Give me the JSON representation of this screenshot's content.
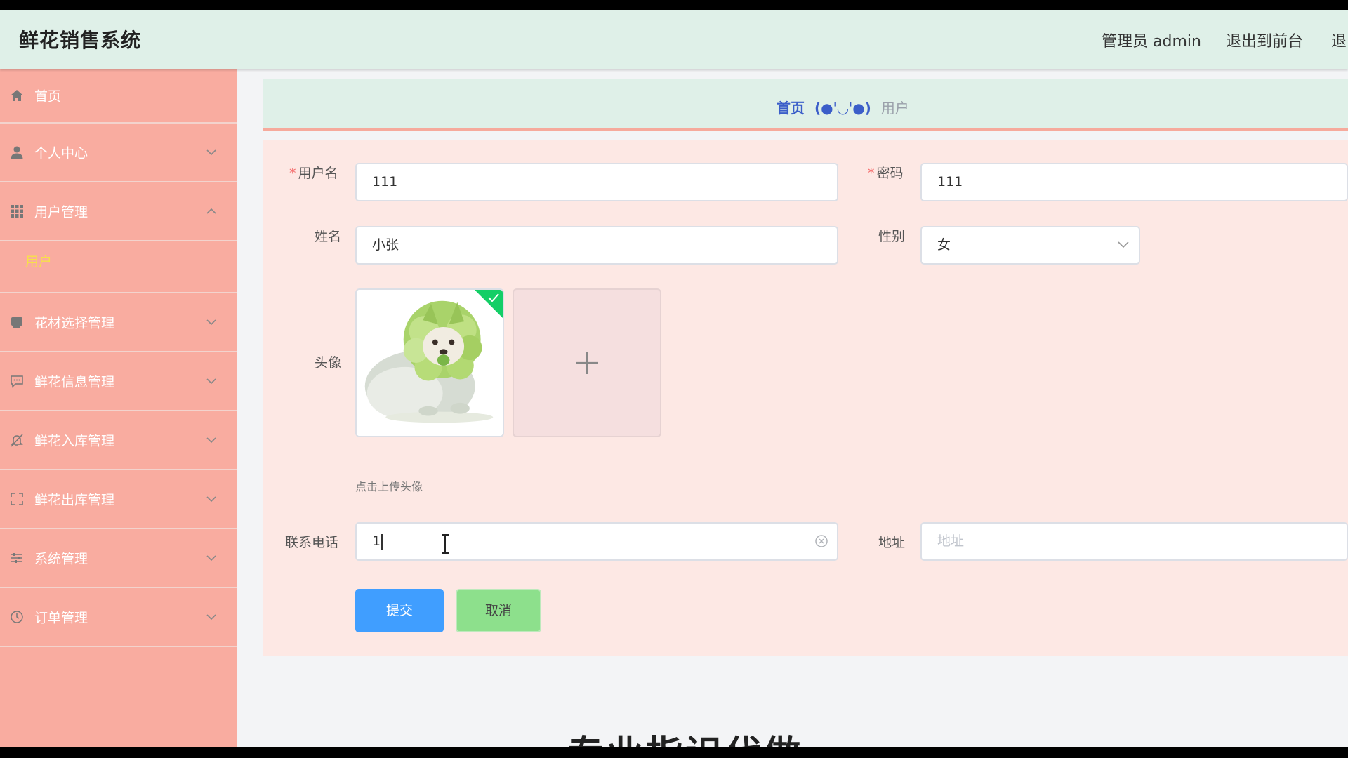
{
  "app": {
    "title": "鲜花销售系统"
  },
  "topbar": {
    "user_text": "管理员 admin",
    "back_front_label": "退出到前台",
    "logout_label": "退出"
  },
  "sidebar": {
    "items": [
      {
        "label": "首页",
        "icon": "home-icon",
        "expandable": false
      },
      {
        "label": "个人中心",
        "icon": "user-icon",
        "expandable": true,
        "expanded": false
      },
      {
        "label": "用户管理",
        "icon": "grid-icon",
        "expandable": true,
        "expanded": true,
        "children": [
          "用户"
        ]
      },
      {
        "label": "花材选择管理",
        "icon": "box-icon",
        "expandable": true,
        "expanded": false
      },
      {
        "label": "鲜花信息管理",
        "icon": "message-icon",
        "expandable": true,
        "expanded": false
      },
      {
        "label": "鲜花入库管理",
        "icon": "bell-off-icon",
        "expandable": true,
        "expanded": false
      },
      {
        "label": "鲜花出库管理",
        "icon": "fullscreen-icon",
        "expandable": true,
        "expanded": false
      },
      {
        "label": "系统管理",
        "icon": "sliders-icon",
        "expandable": true,
        "expanded": false
      },
      {
        "label": "订单管理",
        "icon": "clock-icon",
        "expandable": true,
        "expanded": false
      }
    ],
    "submenu_active_label": "用户",
    "active_color": "#f7e04a"
  },
  "breadcrumb": {
    "home": "首页",
    "separator": "(●'◡'●)",
    "current": "用户"
  },
  "form": {
    "username": {
      "label": "用户名",
      "required": true,
      "value": "111"
    },
    "password": {
      "label": "密码",
      "required": true,
      "value": "111"
    },
    "name": {
      "label": "姓名",
      "required": false,
      "value": "小张"
    },
    "gender": {
      "label": "性别",
      "required": false,
      "value": "女"
    },
    "avatar": {
      "label": "头像",
      "hint": "点击上传头像",
      "uploaded": true
    },
    "phone": {
      "label": "联系电话",
      "required": false,
      "value": "1"
    },
    "address": {
      "label": "地址",
      "required": false,
      "value": "",
      "placeholder": "地址"
    },
    "submit_label": "提交",
    "cancel_label": "取消"
  },
  "colors": {
    "header_bg": "#dff0e8",
    "sidebar_bg": "#f9aca0",
    "form_bg": "#fde8e4",
    "primary": "#409eff",
    "cancel": "#8de08c",
    "success": "#13ce66"
  },
  "overlay": {
    "caption": "专业指识代做"
  }
}
